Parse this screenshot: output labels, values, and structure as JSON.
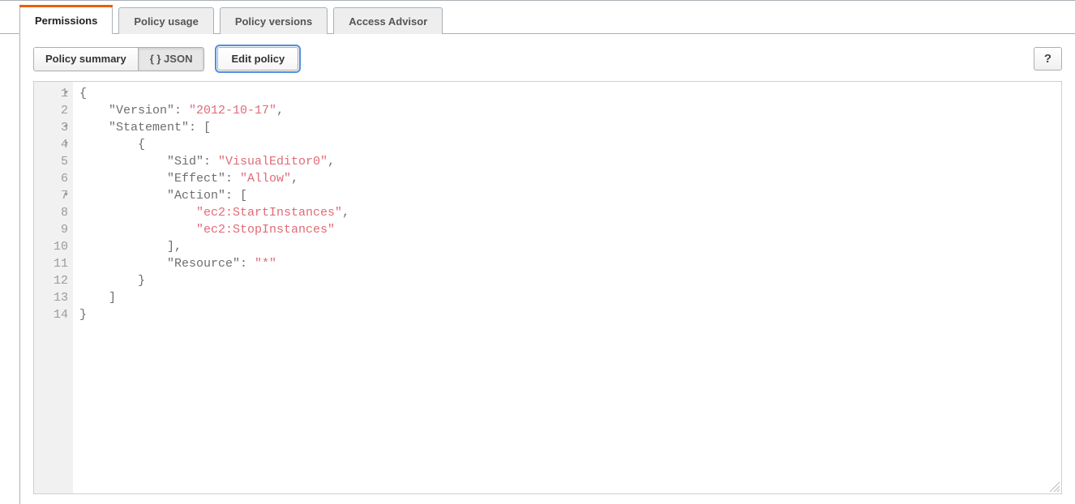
{
  "tabs": {
    "permissions": "Permissions",
    "policy_usage": "Policy usage",
    "policy_versions": "Policy versions",
    "access_advisor": "Access Advisor"
  },
  "toolbar": {
    "policy_summary": "Policy summary",
    "json": "{ } JSON",
    "edit_policy": "Edit policy",
    "help": "?"
  },
  "editor": {
    "line_count": 14,
    "fold_lines": [
      1,
      3,
      4,
      7
    ],
    "tokens": [
      [
        {
          "t": "k",
          "v": "{"
        }
      ],
      [
        {
          "t": "k",
          "v": "    \"Version\": "
        },
        {
          "t": "s",
          "v": "\"2012-10-17\""
        },
        {
          "t": "k",
          "v": ","
        }
      ],
      [
        {
          "t": "k",
          "v": "    \"Statement\": ["
        }
      ],
      [
        {
          "t": "k",
          "v": "        {"
        }
      ],
      [
        {
          "t": "k",
          "v": "            \"Sid\": "
        },
        {
          "t": "s",
          "v": "\"VisualEditor0\""
        },
        {
          "t": "k",
          "v": ","
        }
      ],
      [
        {
          "t": "k",
          "v": "            \"Effect\": "
        },
        {
          "t": "s",
          "v": "\"Allow\""
        },
        {
          "t": "k",
          "v": ","
        }
      ],
      [
        {
          "t": "k",
          "v": "            \"Action\": ["
        }
      ],
      [
        {
          "t": "k",
          "v": "                "
        },
        {
          "t": "s",
          "v": "\"ec2:StartInstances\""
        },
        {
          "t": "k",
          "v": ","
        }
      ],
      [
        {
          "t": "k",
          "v": "                "
        },
        {
          "t": "s",
          "v": "\"ec2:StopInstances\""
        }
      ],
      [
        {
          "t": "k",
          "v": "            ],"
        }
      ],
      [
        {
          "t": "k",
          "v": "            \"Resource\": "
        },
        {
          "t": "s",
          "v": "\"*\""
        }
      ],
      [
        {
          "t": "k",
          "v": "        }"
        }
      ],
      [
        {
          "t": "k",
          "v": "    ]"
        }
      ],
      [
        {
          "t": "k",
          "v": "}"
        }
      ]
    ]
  },
  "policy_json": {
    "Version": "2012-10-17",
    "Statement": [
      {
        "Sid": "VisualEditor0",
        "Effect": "Allow",
        "Action": [
          "ec2:StartInstances",
          "ec2:StopInstances"
        ],
        "Resource": "*"
      }
    ]
  }
}
